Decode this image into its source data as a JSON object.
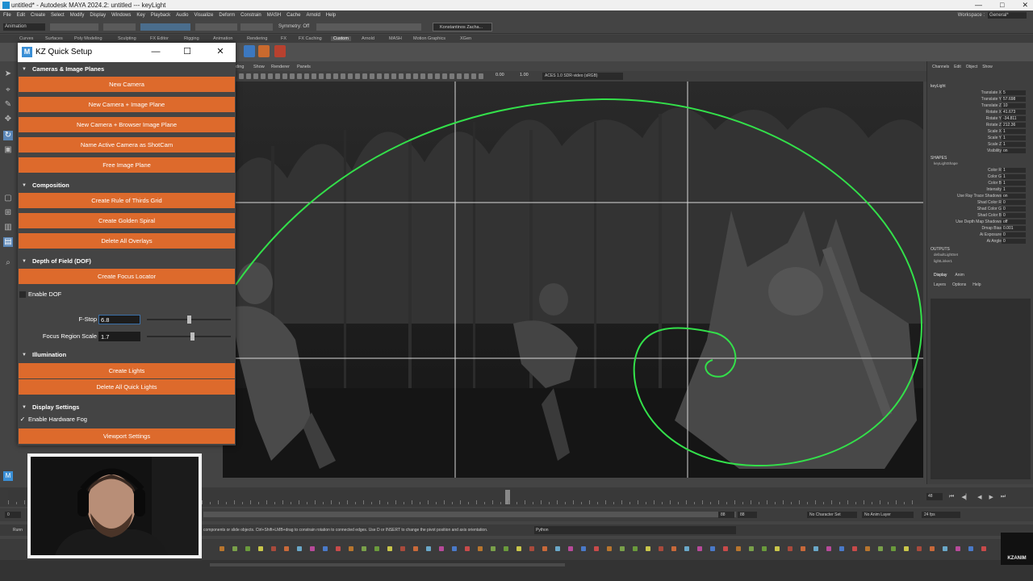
{
  "maya": {
    "title": "untitled* - Autodesk MAYA 2024.2: untitled   ---   keyLight",
    "menu": [
      "File",
      "Edit",
      "Create",
      "Select",
      "Modify",
      "Display",
      "Windows",
      "Key",
      "Playback",
      "Audio",
      "Visualize",
      "Deform",
      "Constrain",
      "MASH",
      "Cache",
      "Arnold",
      "Help"
    ],
    "workspace_label": "Workspace :",
    "workspace_value": "General*",
    "mode": "Animation",
    "symmetry": "Symmetry: Off",
    "user": "Konstantinos Zacha...",
    "shelf_tabs": [
      "Curves",
      "Surfaces",
      "Poly Modeling",
      "Sculpting",
      "FX Editor",
      "Rigging",
      "Animation",
      "Rendering",
      "FX",
      "FX Caching",
      "Custom",
      "Arnold",
      "MASH",
      "Motion Graphics",
      "XGen"
    ],
    "active_shelf": "Custom",
    "panel_menu": [
      "ding",
      "Show",
      "Renderer",
      "Panels"
    ],
    "viewport_values": [
      "0.00",
      "1.00"
    ],
    "colorspace": "ACES 1.0 SDR-video (sRGB)",
    "minimize": "—",
    "maximize": "□",
    "close": "✕"
  },
  "channel_box": {
    "menu": [
      "Channels",
      "Edit",
      "Object",
      "Show"
    ],
    "title": "keyLight",
    "transform": [
      {
        "label": "Translate X",
        "value": "5"
      },
      {
        "label": "Translate Y",
        "value": "57.698"
      },
      {
        "label": "Translate Z",
        "value": "10"
      },
      {
        "label": "Rotate X",
        "value": "41.673"
      },
      {
        "label": "Rotate Y",
        "value": "-34.811"
      },
      {
        "label": "Rotate Z",
        "value": "212.36"
      },
      {
        "label": "Scale X",
        "value": "1"
      },
      {
        "label": "Scale Y",
        "value": "1"
      },
      {
        "label": "Scale Z",
        "value": "1"
      },
      {
        "label": "Visibility",
        "value": "on"
      }
    ],
    "shapes_label": "SHAPES",
    "shape_name": "keyLightShape",
    "shape": [
      {
        "label": "Color R",
        "value": "1"
      },
      {
        "label": "Color G",
        "value": "1"
      },
      {
        "label": "Color B",
        "value": "1"
      },
      {
        "label": "Intensity",
        "value": "1"
      },
      {
        "label": "Use Ray Trace Shadows",
        "value": "on"
      },
      {
        "label": "Shad Color R",
        "value": "0"
      },
      {
        "label": "Shad Color G",
        "value": "0"
      },
      {
        "label": "Shad Color B",
        "value": "0"
      },
      {
        "label": "Use Depth Map Shadows",
        "value": "off"
      },
      {
        "label": "Dmap Bias",
        "value": "0.001"
      },
      {
        "label": "Ai Exposure",
        "value": "0"
      },
      {
        "label": "Ai Angle",
        "value": "0"
      }
    ],
    "outputs_label": "OUTPUTS",
    "outputs": [
      "defaultLightSet",
      "lightLinker1"
    ]
  },
  "layer_panel": {
    "tabs": [
      "Display",
      "Anim"
    ],
    "menu": [
      "Layers",
      "Options",
      "Help"
    ]
  },
  "timeline": {
    "current_frame": "48",
    "playhead_label": "48"
  },
  "range": {
    "start": "0",
    "range_end": "88",
    "end": "88",
    "character_set": "No Character Set",
    "anim_layer": "No Anim Layer",
    "fps": "24 fps"
  },
  "cmdline": {
    "prefix": "Runn",
    "help": "components or slide objects. Ctrl+Shift+LMB+drag to constrain rotation to connected edges. Use D or INSERT to change the pivot position and axis orientation.",
    "python": "Python"
  },
  "kz": {
    "title": "KZ Quick Setup",
    "icon": "M",
    "minimize": "—",
    "maximize": "☐",
    "close": "✕",
    "sections": {
      "cameras": "Cameras & Image Planes",
      "composition": "Composition",
      "dof": "Depth of Field (DOF)",
      "illumination": "Illumination",
      "display": "Display Settings"
    },
    "buttons": {
      "new_camera": "New Camera",
      "new_camera_image_plane": "New Camera + Image Plane",
      "new_camera_browser_plane": "New Camera + Browser Image Plane",
      "name_shotcam": "Name Active Camera as ShotCam",
      "free_image_plane": "Free Image Plane",
      "rule_of_thirds": "Create Rule of Thirds Grid",
      "golden_spiral": "Create Golden Spiral",
      "delete_overlays": "Delete All Overlays",
      "focus_locator": "Create Focus Locator",
      "create_lights": "Create Lights",
      "delete_lights": "Delete All Quick Lights",
      "viewport_settings": "Viewport Settings"
    },
    "enable_dof": {
      "label": "Enable DOF",
      "checked": false,
      "mark": ""
    },
    "fstop": {
      "label": "F-Stop",
      "value": "6.8",
      "slider_fraction": 0.48
    },
    "focus_region": {
      "label": "Focus Region Scale",
      "value": "1.7",
      "slider_fraction": 0.52
    },
    "hardware_fog": {
      "label": "Enable Hardware Fog",
      "checked": true,
      "mark": "✓"
    }
  },
  "watermark": "KZANIM",
  "colors": {
    "button_orange": "#dd6a2c",
    "spiral_green": "#33e04a",
    "maya_dark": "#444444"
  }
}
